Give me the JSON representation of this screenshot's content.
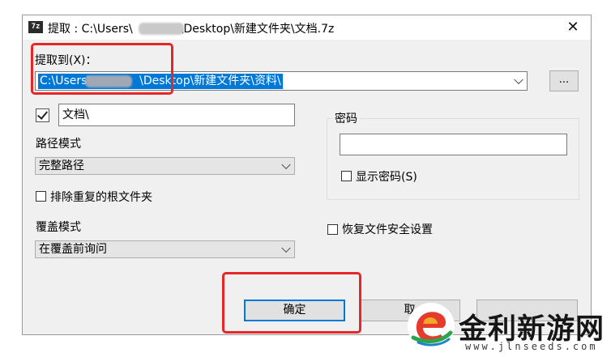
{
  "window": {
    "title_prefix": "提取 : C:\\Users\\",
    "title_suffix": "\\Desktop\\新建文件夹\\文档.7z",
    "close_glyph": "✕",
    "app_icon_text": "7z"
  },
  "extract_to": {
    "label": "提取到(X)：",
    "value_prefix": "C:\\Users\\",
    "value_suffix": "\\Desktop\\新建文件夹\\资料\\",
    "browse_label": "..."
  },
  "subfolder": {
    "checked": true,
    "value": "文档\\"
  },
  "path_mode": {
    "label": "路径模式",
    "selected": "完整路径"
  },
  "eliminate_root": {
    "label": "排除重复的根文件夹",
    "checked": false
  },
  "overwrite_mode": {
    "label": "覆盖模式",
    "selected": "在覆盖前询问"
  },
  "password": {
    "group_label": "密码",
    "value": "",
    "show_label": "显示密码(S)",
    "show_checked": false
  },
  "restore_security": {
    "label": "恢复文件安全设置",
    "checked": false
  },
  "buttons": {
    "ok": "确定",
    "cancel_partial": "取"
  },
  "watermark": {
    "name": "金利新游网",
    "url": "www.jlnseeds.com"
  },
  "colors": {
    "accent": "#0078d7",
    "highlight_red": "#e8262a",
    "dialog_bg": "#f0f0f0"
  }
}
